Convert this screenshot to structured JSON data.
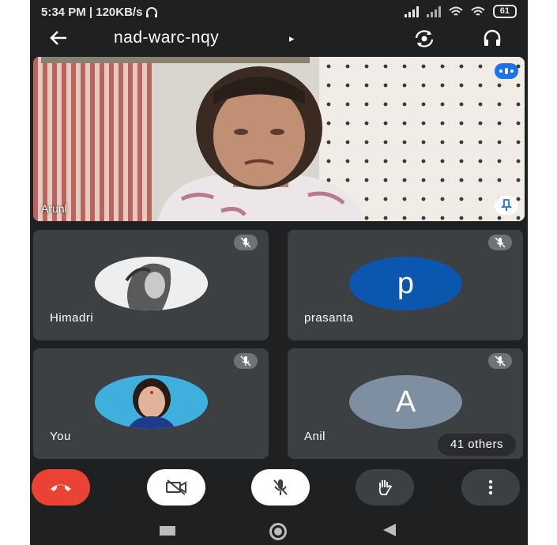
{
  "status": {
    "time_speed": "5:34 PM | 120KB/s",
    "battery": "61"
  },
  "header": {
    "meeting_code": "nad-warc-nqy",
    "caret": "▸"
  },
  "main_video": {
    "participant_name": "Arunl"
  },
  "tiles": [
    {
      "name": "Himadri",
      "avatar_type": "photo"
    },
    {
      "name": "prasanta",
      "avatar_letter": "p",
      "avatar_color": "#0b57b0"
    },
    {
      "name": "You",
      "avatar_type": "photo"
    },
    {
      "name": "Anil",
      "avatar_letter": "A",
      "avatar_color": "#7d8fa0",
      "others_label": "41 others"
    }
  ],
  "controls": {
    "end_call_color": "#ea4335",
    "button_color": "#ffffff",
    "secondary_color": "#3c4043"
  },
  "icons": {
    "back": "arrow-left-icon",
    "switch_camera": "switch-camera-icon",
    "audio_output": "headphones-icon",
    "muted": "mic-off-icon",
    "pin": "pin-icon"
  }
}
